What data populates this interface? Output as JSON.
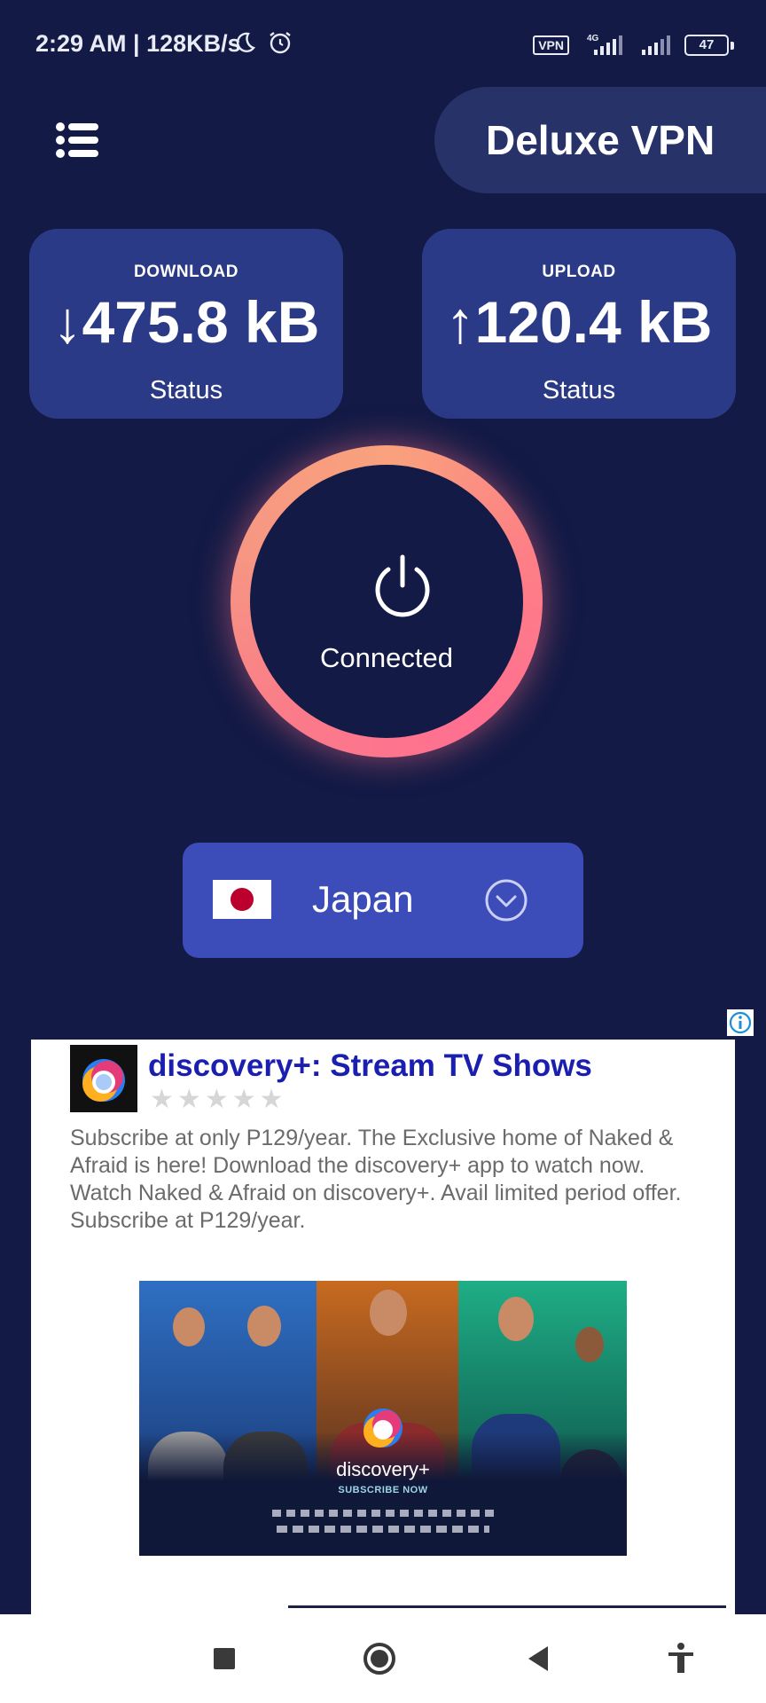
{
  "status_bar": {
    "time": "2:29 AM | 128KB/s",
    "vpn_badge": "VPN",
    "network": "4G",
    "battery": "47"
  },
  "header": {
    "title": "Deluxe VPN"
  },
  "stats": {
    "download": {
      "label": "DOWNLOAD",
      "value": "↓475.8 kB",
      "status": "Status"
    },
    "upload": {
      "label": "UPLOAD",
      "value": "↑120.4 kB",
      "status": "Status"
    }
  },
  "connection": {
    "state_label": "Connected"
  },
  "country": {
    "name": "Japan"
  },
  "ad": {
    "title": "discovery+: Stream TV Shows",
    "rating_stars": 5,
    "body": "Subscribe at only P129/year. The Exclusive home of Naked & Afraid is here! Download the discovery+ app to watch now. Watch Naked & Afraid on discovery+. Avail limited period offer. Subscribe at P129/year.",
    "image_brand": "discovery+",
    "image_cta": "SUBSCRIBE NOW"
  },
  "colors": {
    "background": "#121a45",
    "card": "#2a3a86",
    "country_select": "#3c4cb8",
    "ring_start": "#f9a27d",
    "ring_end": "#ff6f91",
    "ad_title": "#1a1fb0"
  }
}
